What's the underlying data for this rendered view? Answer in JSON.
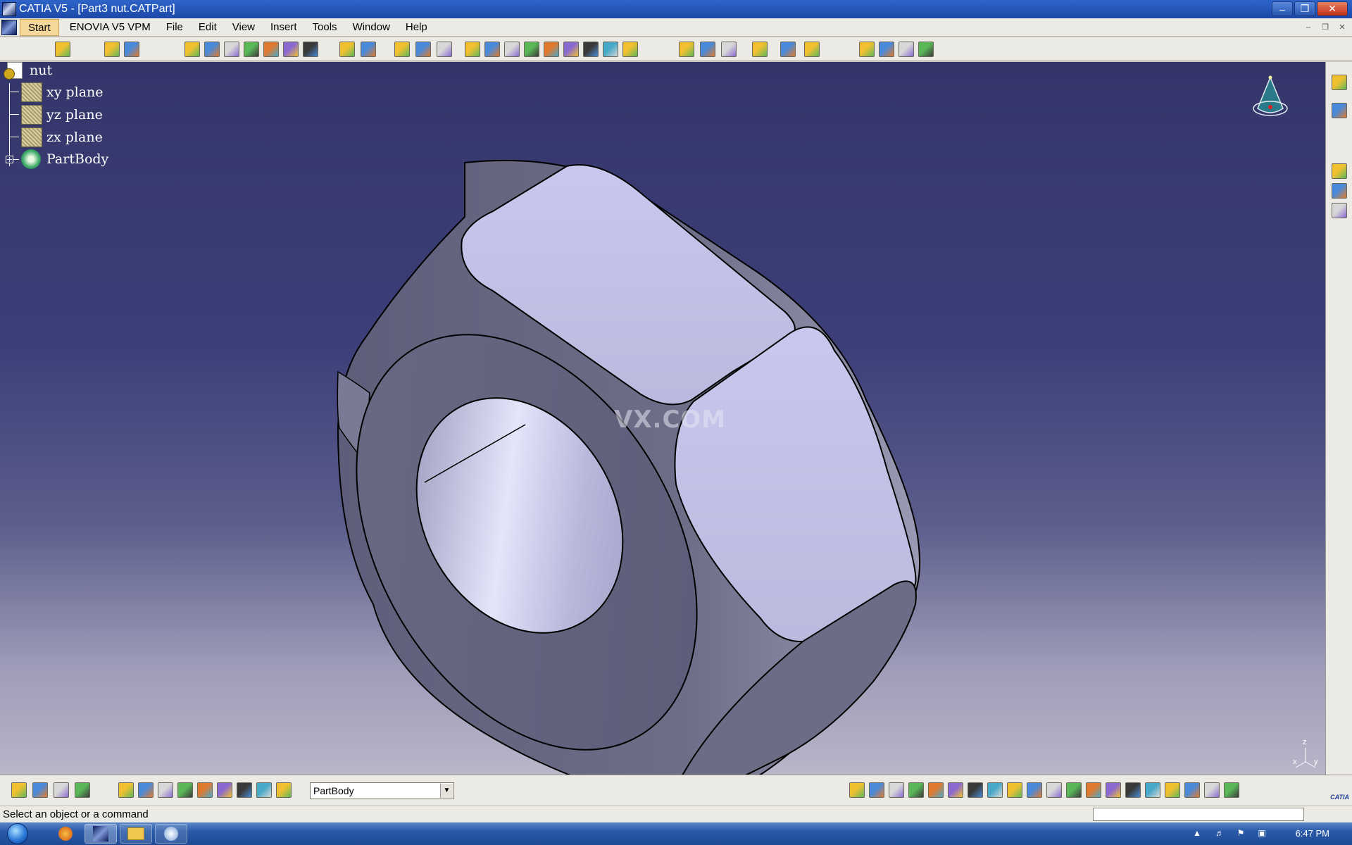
{
  "window": {
    "title": "CATIA V5 - [Part3 nut.CATPart]"
  },
  "menu": {
    "items": [
      "Start",
      "ENOVIA V5 VPM",
      "File",
      "Edit",
      "View",
      "Insert",
      "Tools",
      "Window",
      "Help"
    ]
  },
  "tree": {
    "root": "nut",
    "planes": [
      "xy plane",
      "yz plane",
      "zx plane"
    ],
    "body": "PartBody"
  },
  "viewport": {
    "watermark": "VX.COM",
    "axis_label": "z",
    "axis_label_x": "x",
    "axis_label_y": "y"
  },
  "bottom_toolbar": {
    "current_body": "PartBody"
  },
  "status": {
    "message": "Select an object or a command"
  },
  "taskbar": {
    "clock": "6:47 PM"
  },
  "brand": {
    "footer_logo": "CATIA"
  },
  "colors": {
    "viewport_top": "#34366a",
    "viewport_bottom": "#b8b6c8",
    "nut_face": "#c4c4e8",
    "nut_side": "#6a6a84"
  },
  "icons": {
    "top_toolbar": [
      "sketcher-icon",
      "pad-icon",
      "pocket-icon",
      "shaft-icon",
      "groove-icon",
      "hole-icon",
      "rib-icon",
      "slot-icon",
      "stiffener-icon",
      "solid-combine-icon",
      "multi-pad-icon",
      "fillet-icon",
      "chamfer-icon",
      "draft-icon",
      "shell-icon",
      "thickness-icon",
      "thread-icon",
      "point-icon",
      "line-icon",
      "plane-icon",
      "split-icon",
      "thick-surface-icon",
      "close-surface-icon",
      "sew-surface-icon",
      "translate-icon",
      "rotate-icon",
      "symmetry-icon",
      "mirror-icon",
      "pattern-icon",
      "scale-icon",
      "boolean-icon",
      "select-icon",
      "measure-icon",
      "analysis-icon"
    ],
    "right_toolbar": [
      "view-mode-icon",
      "apply-material-icon",
      "knowledge-icon",
      "formula-icon",
      "catalog-icon"
    ],
    "bottom_toolbar_left": [
      "update-icon",
      "constraint-icon",
      "fix-icon",
      "lock-icon",
      "capture-icon",
      "fly-icon",
      "pan-icon",
      "axis-icon",
      "numeric-icon",
      "wireframe-icon",
      "hide-show-icon",
      "layer-icon",
      "body-icon"
    ],
    "bottom_toolbar_right": [
      "new-icon",
      "open-icon",
      "save-icon",
      "print-icon",
      "cut-icon",
      "copy-icon",
      "paste-icon",
      "undo-icon",
      "redo-icon",
      "whats-this-icon",
      "fit-all-icon",
      "center-icon",
      "pan-view-icon",
      "rotate-view-icon",
      "zoom-in-icon",
      "zoom-out-icon",
      "normal-view-icon",
      "quick-view-icon",
      "view-mode-icon",
      "shading-icon"
    ]
  }
}
